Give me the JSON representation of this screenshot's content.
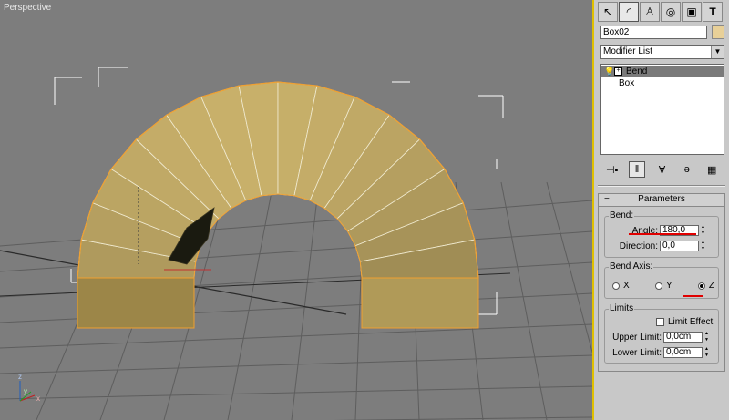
{
  "viewport": {
    "label": "Perspective",
    "colors": {
      "object_fill": "#c8b06a",
      "object_edge": "#f0a030",
      "bbox": "#ffffff",
      "grid": "#5e5e5e"
    },
    "axis_labels": {
      "z": "z",
      "y": "y",
      "x": "x"
    }
  },
  "command_panel": {
    "tabs": [
      {
        "name": "create-tab-icon",
        "glyph": "↖"
      },
      {
        "name": "modify-tab-icon",
        "glyph": "◜"
      },
      {
        "name": "hierarchy-tab-icon",
        "glyph": "♙"
      },
      {
        "name": "motion-tab-icon",
        "glyph": "◎"
      },
      {
        "name": "display-tab-icon",
        "glyph": "▣"
      },
      {
        "name": "utilities-tab-icon",
        "glyph": "T"
      }
    ],
    "object_name": "Box02",
    "object_color": "#e8d098",
    "modifier_list_label": "Modifier List",
    "stack": {
      "bend": "Bend",
      "box": "Box"
    },
    "parameters": {
      "title": "Parameters",
      "bend_group": "Bend:",
      "angle_label": "Angle:",
      "angle_value": "180,0",
      "direction_label": "Direction:",
      "direction_value": "0,0",
      "bend_axis_group": "Bend Axis:",
      "axis_x": "X",
      "axis_y": "Y",
      "axis_z": "Z",
      "selected_axis": "Z",
      "limits_group": "Limits",
      "limit_effect_label": "Limit Effect",
      "upper_limit_label": "Upper Limit:",
      "upper_limit_value": "0,0cm",
      "lower_limit_label": "Lower Limit:",
      "lower_limit_value": "0,0cm"
    }
  }
}
